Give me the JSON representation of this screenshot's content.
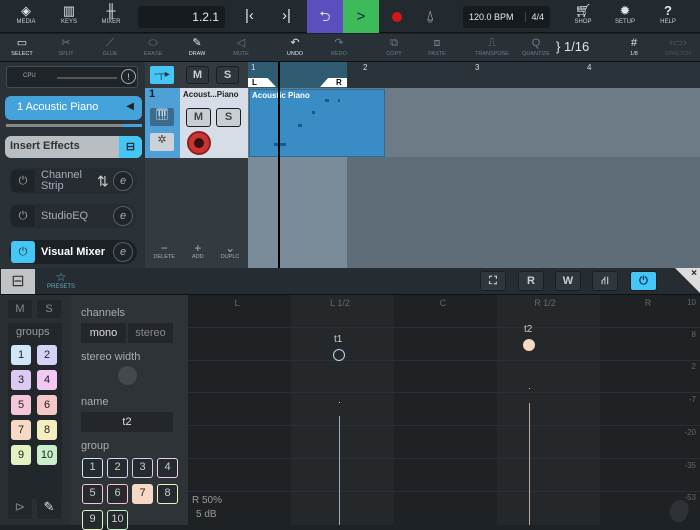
{
  "toolbar": {
    "media": "MEDIA",
    "keys": "KEYS",
    "mixer": "MIXER",
    "position": "1.2.1",
    "bpm": "120.0 BPM",
    "time_sig": "4/4",
    "shop": "SHOP",
    "setup": "SETUP",
    "help": "HELP"
  },
  "tools": {
    "select": "SELECT",
    "split": "SPLIT",
    "glue": "GLUE",
    "erase": "ERASE",
    "draw": "DRAW",
    "mute": "MUTE",
    "undo": "UNDO",
    "redo": "REDO",
    "copy": "COPY",
    "paste": "PASTE",
    "transpose": "TRANSPOSE",
    "quantize": "QUANTIZE",
    "quantize_value": "1/16",
    "grid": "1/8",
    "stretch": "STRETCH"
  },
  "left_panel": {
    "cpu": "CPU",
    "track_name": "1  Acoustic Piano",
    "insert_effects": "Insert Effects",
    "effects": [
      {
        "label": "Channel Strip",
        "active": false
      },
      {
        "label": "StudioEQ",
        "active": false
      },
      {
        "label": "Visual Mixer",
        "active": true
      }
    ]
  },
  "track": {
    "number": "1",
    "name": "Acoust...Piano",
    "mute": "M",
    "solo": "S",
    "delete": "DELETE",
    "add": "ADD",
    "duplicate": "DUPLC"
  },
  "ruler": {
    "bars": [
      "1",
      "2",
      "3",
      "4"
    ],
    "loop_left": "L",
    "loop_right": "R"
  },
  "clip": {
    "name": "Acoustic Piano"
  },
  "mixer": {
    "presets": "PRESETS",
    "mute": "M",
    "solo": "S",
    "groups_label": "groups",
    "groups": [
      "1",
      "2",
      "3",
      "4",
      "5",
      "6",
      "7",
      "8",
      "9",
      "10"
    ],
    "group_colors": [
      "#cfe6f7",
      "#d6d2f7",
      "#dcc9f4",
      "#f1c9f2",
      "#f5c6d9",
      "#f5c7c7",
      "#f6d8c4",
      "#f4eec1",
      "#e3f2c0",
      "#c9f0cb"
    ],
    "channels_label": "channels",
    "mono": "mono",
    "stereo": "stereo",
    "stereo_width_label": "stereo width",
    "name_label": "name",
    "name_value": "t2",
    "group_label": "group",
    "selected_group": "7",
    "pan_labels": [
      "L",
      "L 1/2",
      "C",
      "R 1/2",
      "R"
    ],
    "db_scale": [
      "10",
      "8",
      "2",
      "-7",
      "-20",
      "-35",
      "-53"
    ],
    "tracks": [
      {
        "name": "t1",
        "color": "#b8d8ee",
        "filled": false
      },
      {
        "name": "t2",
        "color": "#f6d8c4",
        "filled": true
      }
    ],
    "readout_pan": "R 50%",
    "readout_db": "5 dB",
    "buttons": {
      "r": "R",
      "w": "W"
    }
  }
}
